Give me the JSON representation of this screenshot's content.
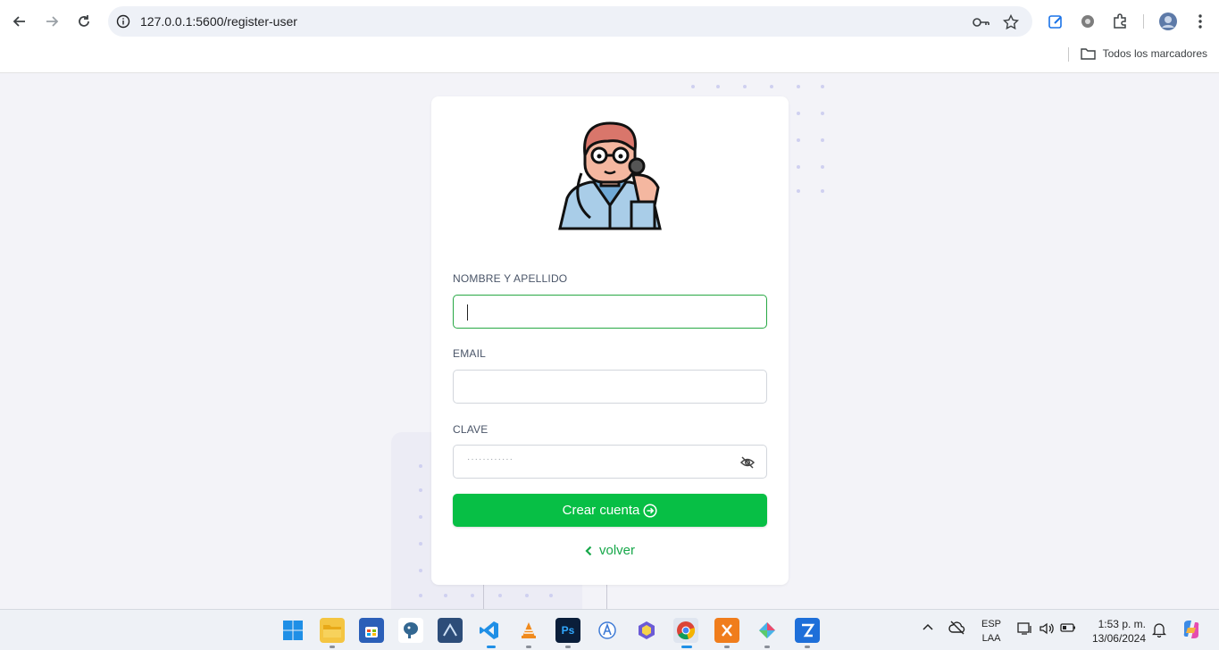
{
  "browser": {
    "url": "127.0.0.1:5600/register-user",
    "bookmarks_label": "Todos los marcadores"
  },
  "form": {
    "name_label": "NOMBRE Y APELLIDO",
    "name_value": "",
    "email_label": "EMAIL",
    "email_value": "",
    "password_label": "CLAVE",
    "password_mask": "············",
    "submit_label": "Crear cuenta",
    "back_label": "volver"
  },
  "taskbar": {
    "language": "ESP",
    "layout": "LAA",
    "time": "1:53 p. m.",
    "date": "13/06/2024"
  },
  "colors": {
    "accent": "#07bf45",
    "focus_border": "#27a844",
    "link": "#17a84a",
    "background": "#f3f3f8"
  }
}
